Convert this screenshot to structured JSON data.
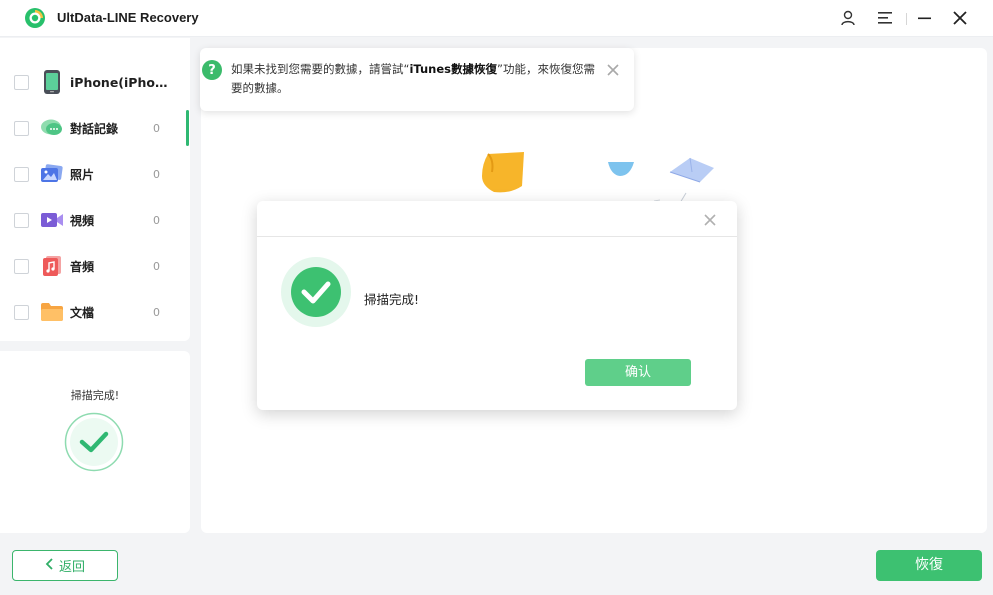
{
  "app": {
    "title": "UltData-LINE Recovery"
  },
  "sidebar": {
    "device": {
      "label": "iPhone(iPho…"
    },
    "items": [
      {
        "label": "對話記錄",
        "count": "0",
        "icon": "chat-bubble-icon"
      },
      {
        "label": "照片",
        "count": "0",
        "icon": "photos-icon"
      },
      {
        "label": "視頻",
        "count": "0",
        "icon": "video-icon"
      },
      {
        "label": "音頻",
        "count": "0",
        "icon": "audio-icon"
      },
      {
        "label": "文檔",
        "count": "0",
        "icon": "folder-icon"
      }
    ],
    "status_text": "掃描完成!"
  },
  "tip": {
    "text_before": "如果未找到您需要的數據，請嘗試“",
    "text_bold": "iTunes數據恢復",
    "text_after": "”功能，來恢復您需要的數據。"
  },
  "dialog": {
    "message": "掃描完成!",
    "confirm_label": "确认"
  },
  "footer": {
    "back_label": "返回",
    "recover_label": "恢復"
  },
  "colors": {
    "accent": "#3dc171",
    "accent_light": "#5fcf8a",
    "check_bg": "#e4f7ec"
  }
}
